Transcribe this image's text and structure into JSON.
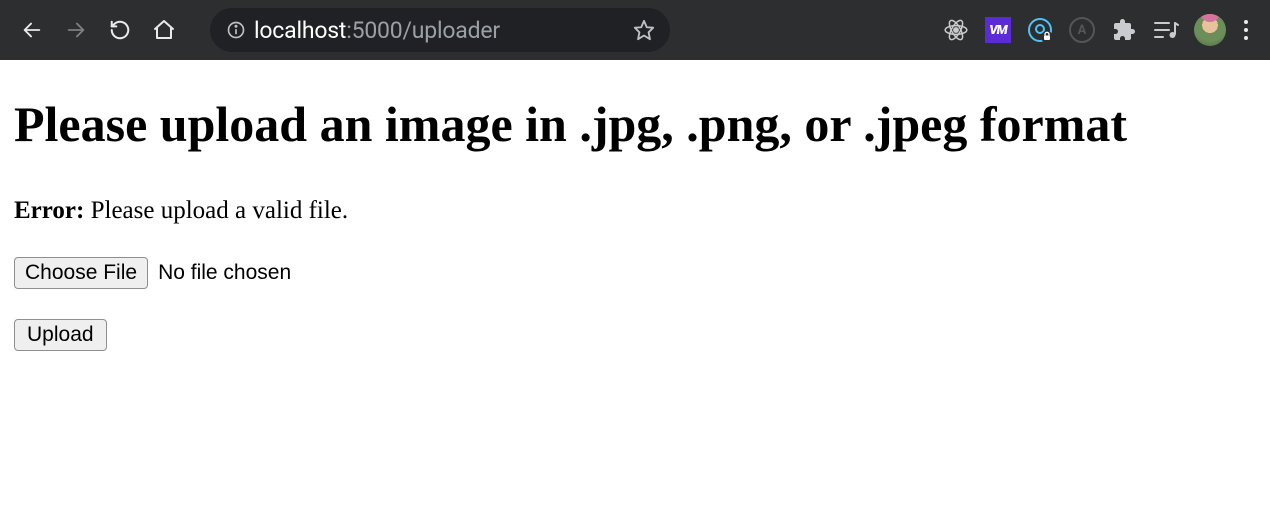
{
  "browser": {
    "url": {
      "host": "localhost",
      "port": ":5000",
      "path": "/uploader"
    },
    "extensions": {
      "vm_label": "VM",
      "a_badge_label": "A"
    }
  },
  "page": {
    "heading": "Please upload an image in .jpg, .png, or .jpeg format",
    "error": {
      "label": "Error:",
      "message": " Please upload a valid file."
    },
    "file_input": {
      "button_label": "Choose File",
      "status_text": "No file chosen"
    },
    "submit_button_label": "Upload"
  }
}
